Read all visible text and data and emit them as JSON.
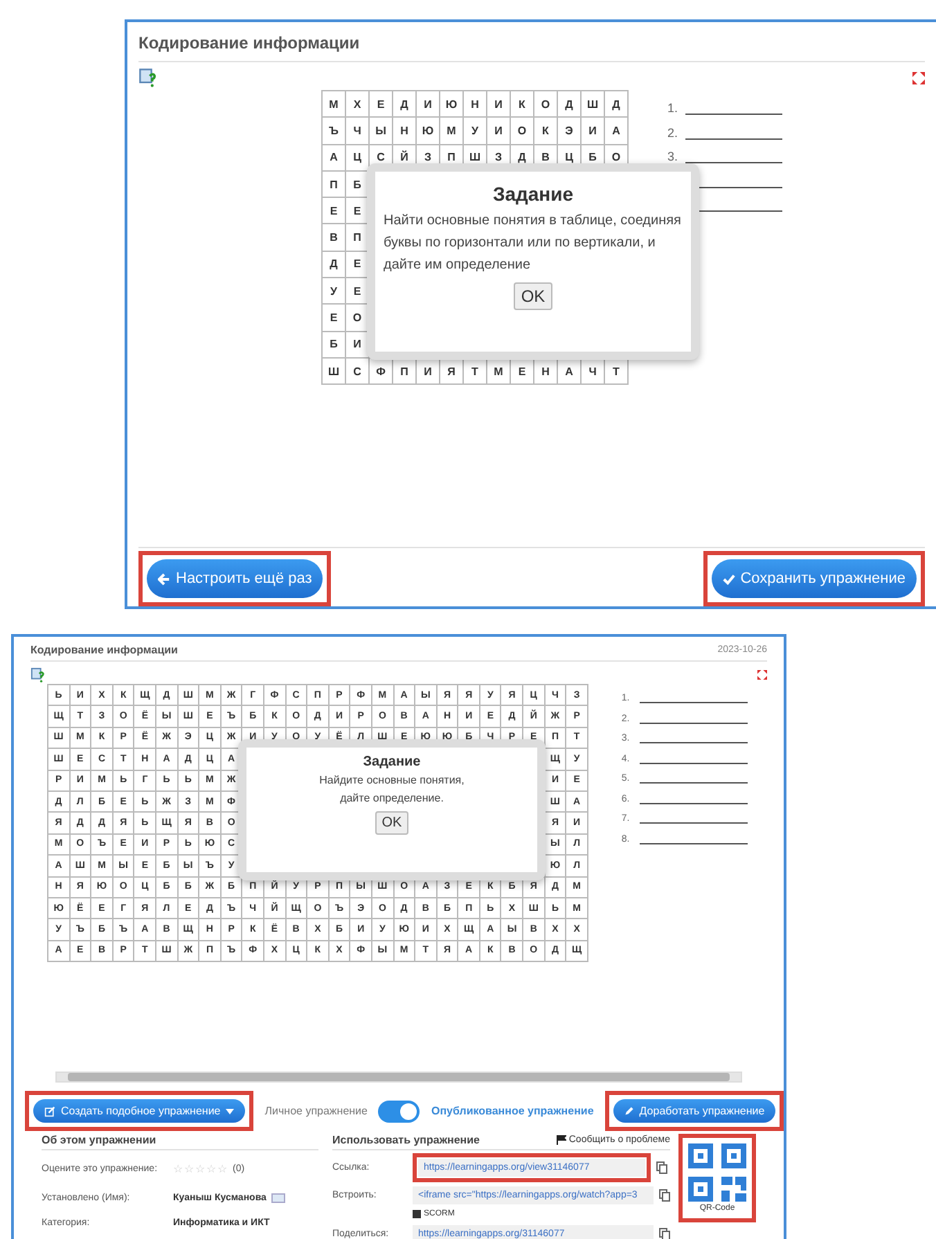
{
  "shot_1": {
    "title": "Кодирование информации",
    "grid": [
      {
        "left": [
          "М",
          "Х",
          "Е",
          "Д",
          "И",
          "Ю",
          "Н",
          "И",
          "К",
          "О",
          "Д",
          "Ш",
          "Д"
        ]
      },
      {
        "left": [
          "Ъ",
          "Ч",
          "Ы",
          "Н",
          "Ю",
          "М",
          "У",
          "И",
          "О",
          "К",
          "Э",
          "И",
          "А"
        ]
      },
      {
        "left": [
          "А",
          "Ц",
          "С",
          "Й",
          "З",
          "П",
          "Ш",
          "З",
          "Д",
          "В",
          "Ц",
          "Б",
          "О"
        ]
      },
      {
        "left": [
          "П",
          "Б"
        ]
      },
      {
        "left": [
          "Е",
          "Е"
        ]
      },
      {
        "left": [
          "В",
          "П"
        ]
      },
      {
        "left": [
          "Д",
          "Е"
        ]
      },
      {
        "left": [
          "У",
          "Е"
        ]
      },
      {
        "left": [
          "Е",
          "О"
        ]
      },
      {
        "left": [
          "Б",
          "И"
        ]
      },
      {
        "left": [
          "Ш",
          "С",
          "Ф",
          "П",
          "И",
          "Я",
          "Т",
          "М",
          "Е",
          "Н",
          "А",
          "Ч",
          "Т"
        ]
      }
    ],
    "answers": [
      {
        "kind": "numbered",
        "number": "1."
      },
      {
        "kind": "numbered",
        "number": "2."
      },
      {
        "kind": "numbered",
        "number": "3."
      },
      {
        "kind": "line"
      },
      {
        "kind": "line"
      }
    ],
    "dialog": {
      "title": "Задание",
      "text": "Найти основные понятия в таблице, соединяя буквы по горизонтали или по вертикали, и дайте им определение",
      "button": "OK"
    },
    "buttons": [
      {
        "label": "Настроить ещё раз",
        "kind": "back"
      },
      {
        "label": "Сохранить упражнение",
        "kind": "save"
      }
    ]
  },
  "shot_2": {
    "title": "Кодирование информации",
    "date": "2023-10-26",
    "grid": [
      {
        "left": [
          "Ь",
          "И",
          "Х",
          "К",
          "Щ",
          "Д",
          "Ш",
          "М",
          "Ж",
          "Г",
          "Ф",
          "С",
          "П",
          "Р",
          "Ф",
          "М",
          "А",
          "Ы",
          "Я",
          "Я",
          "У",
          "Я",
          "Ц",
          "Ч",
          "З"
        ]
      },
      {
        "left": [
          "Щ",
          "Т",
          "З",
          "О",
          "Ё",
          "Ы",
          "Ш",
          "Е",
          "Ъ",
          "Б",
          "К",
          "О",
          "Д",
          "И",
          "Р",
          "О",
          "В",
          "А",
          "Н",
          "И",
          "Е",
          "Д",
          "Й",
          "Ж",
          "Р"
        ]
      },
      {
        "left": [
          "Ш",
          "М",
          "К",
          "Р",
          "Ё",
          "Ж",
          "Э",
          "Ц",
          "Ж",
          "И",
          "У",
          "О",
          "У",
          "Ё",
          "Л",
          "Ш",
          "Е",
          "Ю",
          "Ю",
          "Б",
          "Ч",
          "Р",
          "Е",
          "П",
          "Т"
        ]
      },
      {
        "left": [
          "Ш",
          "Е",
          "С",
          "Т",
          "Н",
          "А",
          "Д",
          "Ц",
          "А"
        ],
        "right": [
          "Щ",
          "У"
        ]
      },
      {
        "left": [
          "Р",
          "И",
          "М",
          "Ь",
          "Г",
          "Ь",
          "Ь",
          "М",
          "Ж"
        ],
        "right": [
          "И",
          "Е"
        ]
      },
      {
        "left": [
          "Д",
          "Л",
          "Б",
          "Е",
          "Ь",
          "Ж",
          "З",
          "М",
          "Ф"
        ],
        "right": [
          "Ш",
          "А"
        ]
      },
      {
        "left": [
          "Я",
          "Д",
          "Д",
          "Я",
          "Ь",
          "Щ",
          "Я",
          "В",
          "О"
        ],
        "right": [
          "Я",
          "И"
        ]
      },
      {
        "left": [
          "М",
          "О",
          "Ъ",
          "Е",
          "И",
          "Р",
          "Ь",
          "Ю",
          "С"
        ],
        "right": [
          "Ы",
          "Л"
        ]
      },
      {
        "left": [
          "А",
          "Ш",
          "М",
          "Ы",
          "Е",
          "Б",
          "Ы",
          "Ъ",
          "У"
        ],
        "right": [
          "Ю",
          "Л"
        ]
      },
      {
        "left": [
          "Н",
          "Я",
          "Ю",
          "О",
          "Ц",
          "Б",
          "Б",
          "Ж",
          "Б",
          "П",
          "Й",
          "У",
          "Р",
          "П",
          "Ы",
          "Ш",
          "О",
          "А",
          "З",
          "Е",
          "К",
          "Б",
          "Я",
          "Д",
          "М"
        ]
      },
      {
        "left": [
          "Ю",
          "Ё",
          "Е",
          "Г",
          "Я",
          "Л",
          "Е",
          "Д",
          "Ъ",
          "Ч",
          "Й",
          "Щ",
          "О",
          "Ъ",
          "Э",
          "О",
          "Д",
          "В",
          "Б",
          "П",
          "Ь",
          "Х",
          "Ш",
          "Ь",
          "М"
        ]
      },
      {
        "left": [
          "У",
          "Ъ",
          "Б",
          "Ъ",
          "А",
          "В",
          "Щ",
          "Н",
          "Р",
          "К",
          "Ё",
          "В",
          "Х",
          "Б",
          "И",
          "У",
          "Ю",
          "И",
          "Х",
          "Щ",
          "А",
          "Ы",
          "В",
          "Х",
          "Х"
        ]
      },
      {
        "left": [
          "А",
          "Е",
          "В",
          "Р",
          "Т",
          "Ш",
          "Ж",
          "П",
          "Ъ",
          "Ф",
          "Х",
          "Ц",
          "К",
          "Х",
          "Ф",
          "Ы",
          "М",
          "Т",
          "Я",
          "А",
          "К",
          "В",
          "О",
          "Д",
          "Щ"
        ]
      }
    ],
    "answers": [
      {
        "kind": "numbered",
        "number": "1."
      },
      {
        "kind": "numbered",
        "number": "2."
      },
      {
        "kind": "numbered",
        "number": "3."
      },
      {
        "kind": "numbered",
        "number": "4."
      },
      {
        "kind": "numbered",
        "number": "5."
      },
      {
        "kind": "numbered",
        "number": "6."
      },
      {
        "kind": "numbered",
        "number": "7."
      },
      {
        "kind": "numbered",
        "number": "8."
      }
    ],
    "dialog": {
      "title": "Задание",
      "text": "Найдите основные понятия, дайте определение.",
      "button": "OK"
    },
    "create_button": "Создать подобное упражнение",
    "toggle": {
      "left_label": "Личное упражнение",
      "right_label": "Опубликованное упражнение",
      "on": true
    },
    "improve_button": "Доработать упражнение",
    "about": {
      "heading": "Об этом упражнении",
      "rate_label": "Оцените это упражнение:",
      "stars": 0,
      "rating_count": "(0)",
      "author_label": "Установлено (Имя):",
      "author": "Куаныш Кусманова",
      "category_label": "Категория:",
      "category": "Информатика и ИКТ"
    },
    "use": {
      "heading": "Использовать упражнение",
      "report": "Сообщить о проблеме",
      "link_label": "Ссылка:",
      "link": "https://learningapps.org/view31146077",
      "embed_label": "Встроить:",
      "embed": "<iframe src=\"https://learningapps.org/watch?app=3",
      "scorm": "SCORM",
      "share_label": "Поделиться:",
      "share": "https://learningapps.org/31146077",
      "qr_label": "QR-Code"
    }
  }
}
